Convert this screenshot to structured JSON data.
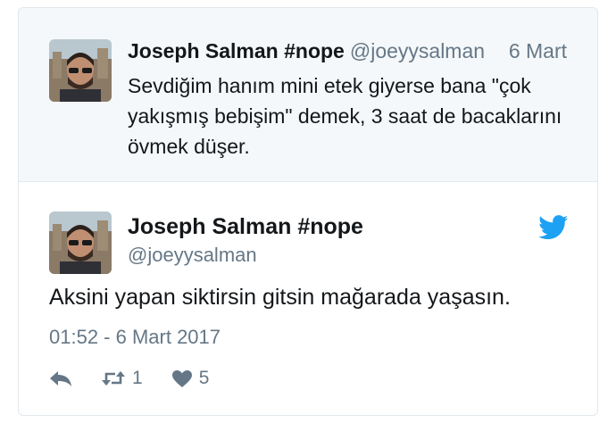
{
  "parent_tweet": {
    "name": "Joseph Salman #nope",
    "handle": "@joeyysalman",
    "date": "6 Mart",
    "text": "Sevdiğim hanım mini etek giyerse bana \"çok yakışmış bebişim\" demek, 3 saat de bacaklarını övmek düşer."
  },
  "main_tweet": {
    "name": "Joseph Salman #nope",
    "handle": "@joeyysalman",
    "text": "Aksini yapan siktirsin gitsin mağarada yaşasın.",
    "timestamp": "01:52 - 6 Mart 2017",
    "retweet_count": "1",
    "like_count": "5"
  },
  "icons": {
    "brand": "twitter-bird-icon",
    "reply": "reply-icon",
    "retweet": "retweet-icon",
    "like": "heart-icon"
  },
  "colors": {
    "brand_blue": "#1da1f2",
    "muted": "#657786",
    "text": "#14171a",
    "parent_bg": "#f5f8fa"
  }
}
